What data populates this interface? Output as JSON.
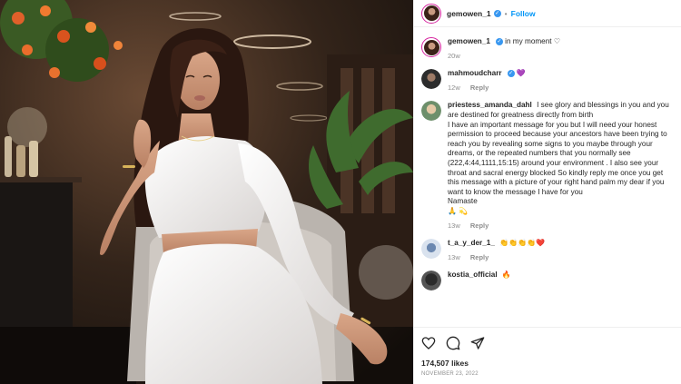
{
  "header": {
    "username": "gemowen_1",
    "verified_badge": "✓",
    "separator": "•",
    "follow_label": "Follow"
  },
  "caption": {
    "username": "gemowen_1",
    "text": "in my moment ♡",
    "age": "20w"
  },
  "comments": [
    {
      "username": "mahmoudcharr",
      "text": "💜",
      "age": "12w",
      "reply_label": "Reply"
    },
    {
      "username": "priestess_amanda_dahl",
      "text": "I see glory and blessings in you and you are destined for greatness directly from birth",
      "text2": "I have an important message for you but I will need your honest permission to proceed because your ancestors have been trying to reach you by revealing some signs to you maybe through your dreams, or the repeated numbers that you normally see (222,4:44,1111,15:15) around your environment . I also see your throat and sacral energy blocked So kindly reply me once you get this message with a picture of your right hand palm my dear if you want to know the message I have for you",
      "text3": "Namaste",
      "text4": "🙏 💫",
      "age": "13w",
      "reply_label": "Reply"
    },
    {
      "username": "t_a_y_der_1_",
      "text": "👏👏👏👏❤️",
      "age": "13w",
      "reply_label": "Reply"
    },
    {
      "username": "kostia_official",
      "text": "🔥"
    }
  ],
  "actions": {
    "likes": "174,507 likes",
    "date": "NOVEMBER 23, 2022"
  },
  "icons": [
    "heart-icon",
    "comment-icon",
    "share-icon"
  ],
  "colors": {
    "accent": "#0095f6",
    "verified": "#3897f0",
    "muted": "#8e8e8e",
    "text": "#262626"
  }
}
